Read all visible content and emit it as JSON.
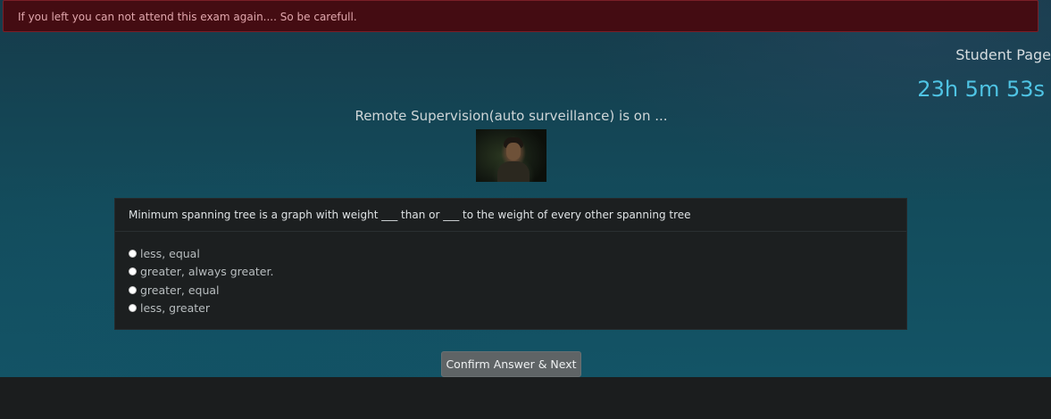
{
  "alert": {
    "message": "If you left you can not attend this exam again.... So be carefull."
  },
  "header": {
    "page_title": "Student Page",
    "timer": "23h 5m 53s"
  },
  "supervision": {
    "text": "Remote Supervision(auto surveillance) is on ..."
  },
  "question": {
    "text": "Minimum spanning tree is a graph with weight ___ than or ___ to the weight of every other spanning tree",
    "options": [
      {
        "label": "less, equal",
        "selected": false
      },
      {
        "label": "greater, always greater.",
        "selected": false
      },
      {
        "label": "greater, equal",
        "selected": false
      },
      {
        "label": "less, greater",
        "selected": false
      }
    ]
  },
  "actions": {
    "confirm_label": "Confirm Answer & Next"
  }
}
